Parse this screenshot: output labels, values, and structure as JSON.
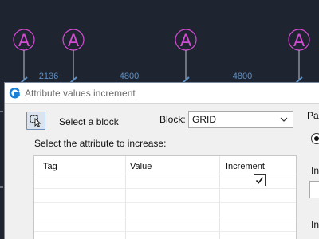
{
  "drawing": {
    "grid_bubbles": [
      "A",
      "A",
      "A",
      "A"
    ],
    "dimensions": [
      "2136",
      "4800",
      "4800"
    ],
    "colors": {
      "background": "#1f2530",
      "bubble": "#d24bd2",
      "dimension": "#5e8fc4"
    }
  },
  "dialog": {
    "title": "Attribute values increment",
    "select_block_label": "Select a block",
    "block_label": "Block:",
    "block_value": "GRID",
    "attribute_label": "Select the attribute to increase:",
    "table": {
      "columns": [
        "Tag",
        "Value",
        "Increment"
      ],
      "rows": [
        {
          "tag": "",
          "value": "",
          "increment": true
        }
      ]
    },
    "right_panel": {
      "label_top": "Pa",
      "label_mid": "In",
      "label_bottom": "In"
    }
  }
}
